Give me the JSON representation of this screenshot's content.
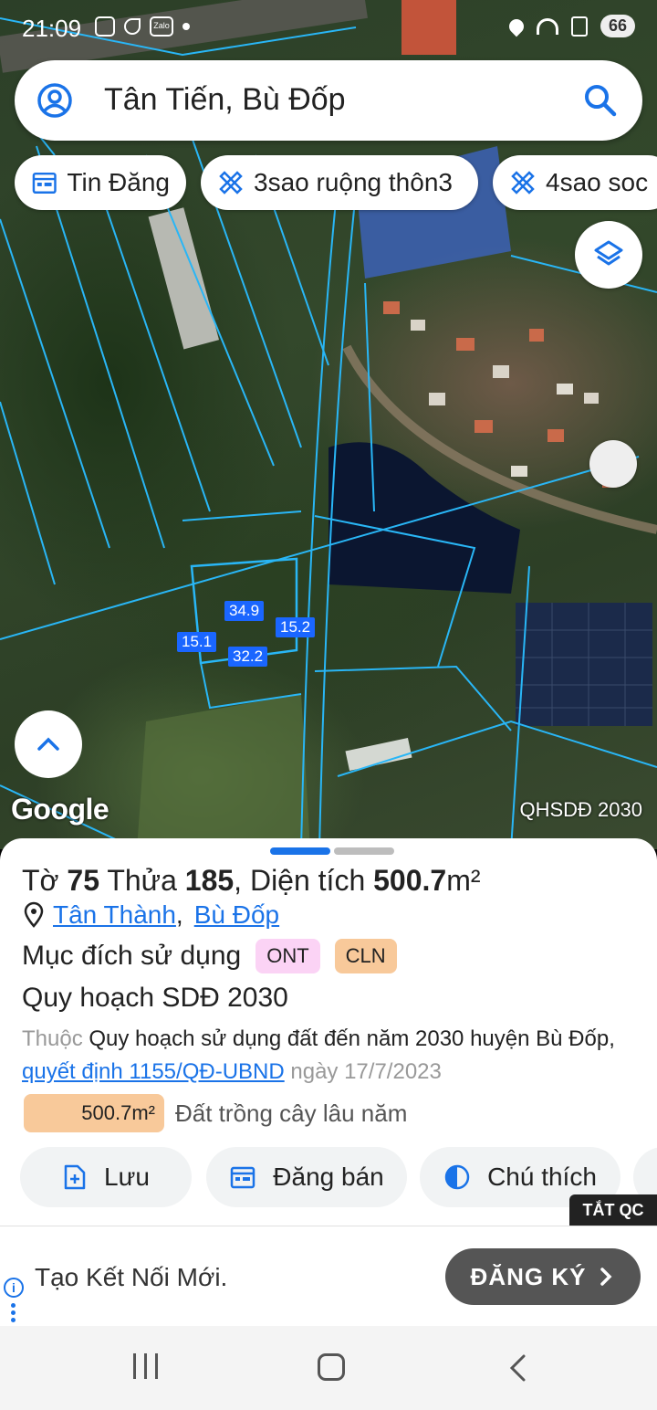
{
  "status_bar": {
    "time": "21:09",
    "battery": "66"
  },
  "search": {
    "text": "Tân Tiến, Bù Đốp"
  },
  "chips": [
    {
      "label": "Tin Đăng",
      "icon": "calendar-icon"
    },
    {
      "label": "3sao ruộng thôn3",
      "icon": "ruler-icon"
    },
    {
      "label": "4sao soc",
      "icon": "ruler-icon"
    }
  ],
  "map": {
    "google_label": "Google",
    "layer_tag": "QHSDĐ 2030",
    "dimensions": {
      "top": "34.9",
      "right": "15.2",
      "left": "15.1",
      "bottom": "32.2"
    }
  },
  "parcel": {
    "title_prefix": "Tờ",
    "sheet_no": "75",
    "plot_label": "Thửa",
    "plot_no": "185",
    "area_label": ", Diện tích",
    "area_value": "500.7",
    "area_unit": "m²",
    "commune": "Tân Thành",
    "separator": ",",
    "district": "Bù Đốp",
    "purpose_label": "Mục đích sử dụng",
    "purpose_badges": [
      {
        "code": "ONT",
        "color": "#fbd3f5"
      },
      {
        "code": "CLN",
        "color": "#f8c99a"
      }
    ],
    "plan_title": "Quy hoạch SDĐ 2030",
    "desc_prefix": "Thuộc",
    "desc_plan": "Quy hoạch sử dụng đất đến năm 2030 huyện Bù Đốp",
    "desc_comma": ",",
    "desc_decision": "quyết định 1155/QĐ-UBND",
    "desc_date": "ngày 17/7/2023",
    "area_pill": "500.7m²",
    "area_land_type": "Đất trồng cây lâu năm"
  },
  "actions": [
    {
      "label": "Lưu",
      "icon": "save-plus-icon"
    },
    {
      "label": "Đăng bán",
      "icon": "calendar-icon"
    },
    {
      "label": "Chú thích",
      "icon": "contrast-icon"
    }
  ],
  "ad": {
    "close_label": "TẮT QC",
    "text": "Tạo Kết Nối Mới.",
    "button_label": "ĐĂNG KÝ"
  },
  "colors": {
    "accent": "#1a73e8",
    "handle_active": "#1a73e8",
    "handle_inactive": "#bdbdbd",
    "parcel_line": "#29b6f6"
  }
}
